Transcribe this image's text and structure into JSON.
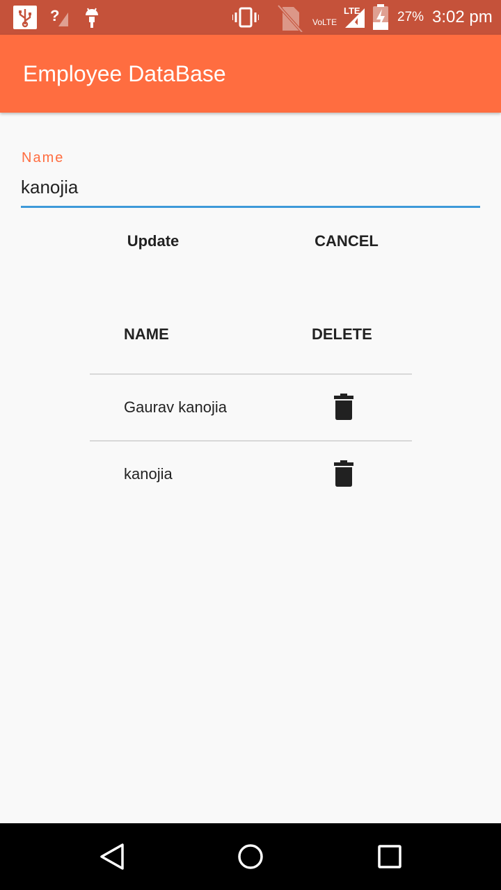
{
  "status_bar": {
    "icons": [
      "usb-icon",
      "no-signal-icon",
      "android-debug-icon",
      "vibrate-icon",
      "no-sim-icon",
      "lte-signal-icon",
      "battery-charging-icon"
    ],
    "network": "VoLTE",
    "lte": "LTE",
    "battery": "27%",
    "time": "3:02 pm"
  },
  "app_bar": {
    "title": "Employee DataBase",
    "color": "#ff6d40"
  },
  "form": {
    "label": "Name",
    "value": "kanojia",
    "update_label": "Update",
    "cancel_label": "CANCEL"
  },
  "table": {
    "headers": {
      "name": "NAME",
      "delete": "DELETE"
    },
    "rows": [
      {
        "name": "Gaurav kanojia",
        "delete_icon": "trash-icon"
      },
      {
        "name": "kanojia",
        "delete_icon": "trash-icon"
      }
    ]
  },
  "nav_bar": {
    "buttons": [
      "back-icon",
      "home-icon",
      "recents-icon"
    ]
  }
}
